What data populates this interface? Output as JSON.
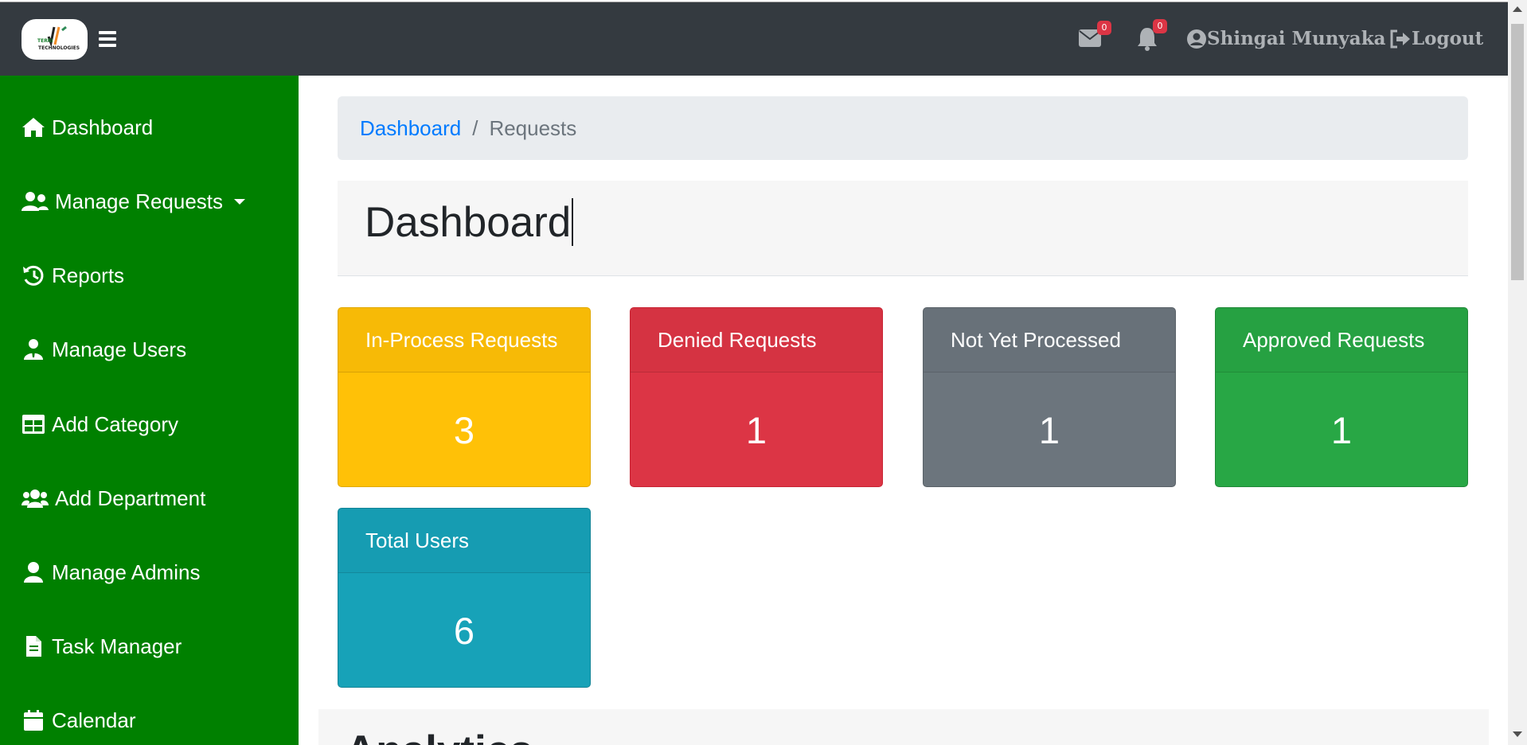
{
  "app": {
    "logo_text_top": "TERRI",
    "logo_text_bottom": "TECHNOLOGIES"
  },
  "topbar": {
    "messages_count": "0",
    "notifications_count": "0",
    "user_name": "Shingai Munyaka",
    "logout_label": "Logout"
  },
  "sidebar": {
    "items": [
      {
        "label": "Dashboard",
        "icon": "home-icon"
      },
      {
        "label": "Manage Requests",
        "icon": "user-group-icon"
      },
      {
        "label": "Reports",
        "icon": "history-icon"
      },
      {
        "label": "Manage Users",
        "icon": "user-tie-icon"
      },
      {
        "label": "Add Category",
        "icon": "table-icon"
      },
      {
        "label": "Add Department",
        "icon": "users-icon"
      },
      {
        "label": "Manage Admins",
        "icon": "user-icon"
      },
      {
        "label": "Task Manager",
        "icon": "file-icon"
      },
      {
        "label": "Calendar",
        "icon": "calendar-icon"
      }
    ]
  },
  "breadcrumb": {
    "link": "Dashboard",
    "active": "Requests"
  },
  "page": {
    "title": "Dashboard"
  },
  "cards": [
    {
      "title": "In-Process Requests",
      "value": "3",
      "color": "#ffc107"
    },
    {
      "title": "Denied Requests",
      "value": "1",
      "color": "#dc3545"
    },
    {
      "title": "Not Yet Processed",
      "value": "1",
      "color": "#6c757d"
    },
    {
      "title": "Approved Requests",
      "value": "1",
      "color": "#28a745"
    },
    {
      "title": "Total Users",
      "value": "6",
      "color": "#17a2b8"
    }
  ],
  "analytics": {
    "title": "Analytics"
  }
}
